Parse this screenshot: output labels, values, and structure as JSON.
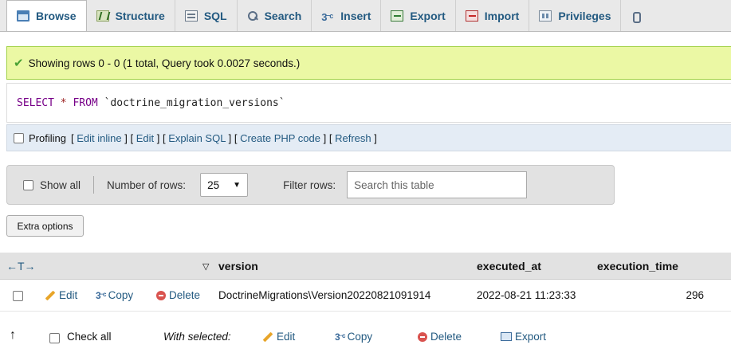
{
  "tabs": [
    {
      "label": "Browse",
      "icon": "browse-icon"
    },
    {
      "label": "Structure",
      "icon": "structure-icon"
    },
    {
      "label": "SQL",
      "icon": "sql-icon"
    },
    {
      "label": "Search",
      "icon": "search-icon"
    },
    {
      "label": "Insert",
      "icon": "insert-icon"
    },
    {
      "label": "Export",
      "icon": "export-icon"
    },
    {
      "label": "Import",
      "icon": "import-icon"
    },
    {
      "label": "Privileges",
      "icon": "privileges-icon"
    }
  ],
  "status": {
    "message": "Showing rows 0 - 0 (1 total, Query took 0.0027 seconds.)",
    "color": "#ebf8a4"
  },
  "query": {
    "select": "SELECT",
    "star": "*",
    "from": "FROM",
    "table": "`doctrine_migration_versions`"
  },
  "profiling": {
    "label": "Profiling",
    "links": [
      "Edit inline",
      "Edit",
      "Explain SQL",
      "Create PHP code",
      "Refresh"
    ]
  },
  "navigation": {
    "show_all": "Show all",
    "rows_label": "Number of rows:",
    "rows_value": "25",
    "filter_label": "Filter rows:",
    "filter_placeholder": "Search this table"
  },
  "extra_options": "Extra options",
  "table": {
    "arrows": "←T→",
    "headers": [
      "version",
      "executed_at",
      "execution_time"
    ],
    "sort_icon": "sort-down-icon",
    "rows": [
      {
        "actions": [
          "Edit",
          "Copy",
          "Delete"
        ],
        "version": "DoctrineMigrations\\Version20220821091914",
        "executed_at": "2022-08-21 11:23:33",
        "execution_time": "296"
      }
    ]
  },
  "bottom": {
    "up_arrow": "↑",
    "check_all": "Check all",
    "with_selected": "With selected:",
    "edit": "Edit",
    "copy": "Copy",
    "delete": "Delete",
    "export": "Export"
  },
  "accent_color": "#235a81"
}
